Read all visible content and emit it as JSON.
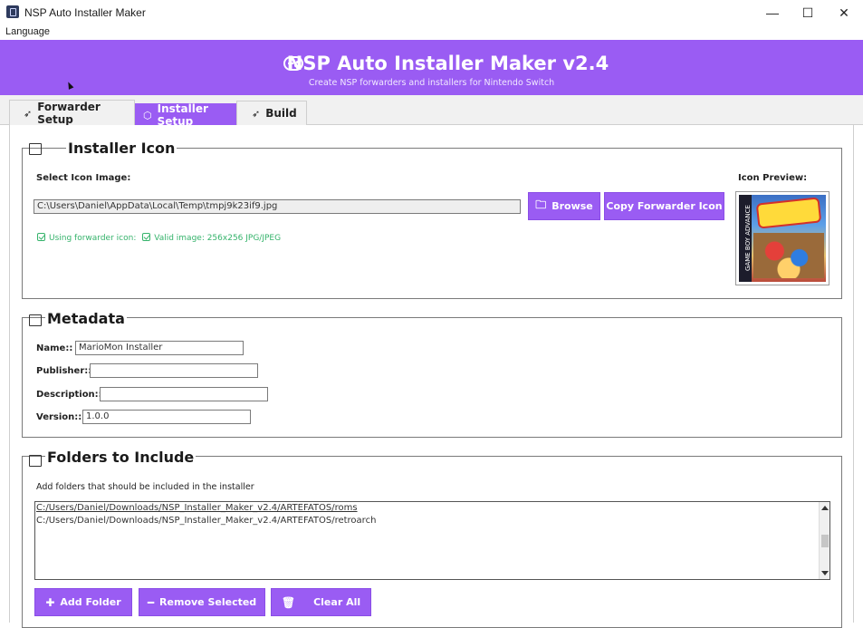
{
  "window": {
    "title": "NSP Auto Installer Maker",
    "controls": {
      "minimize": "—",
      "maximize": "☐",
      "close": "✕"
    }
  },
  "menu": {
    "items": [
      "Language"
    ]
  },
  "banner": {
    "title": "NSP Auto Installer Maker v2.4",
    "subtitle": "Create NSP forwarders and installers for Nintendo Switch",
    "icon": "gamepad-icon",
    "color": "#9a5cf3"
  },
  "tabs": [
    {
      "label": "Forwarder Setup",
      "icon": "rocket-icon",
      "active": false
    },
    {
      "label": "Installer Setup",
      "icon": "box-icon",
      "active": true
    },
    {
      "label": "Build",
      "icon": "rocket-icon",
      "active": false
    }
  ],
  "installer_icon": {
    "title": "Installer Icon",
    "select_label": "Select Icon Image:",
    "path": "C:\\Users\\Daniel\\AppData\\Local\\Temp\\tmpj9k23if9.jpg",
    "browse_label": "Browse",
    "copy_label": "Copy Forwarder Icon",
    "status_forwarder": "Using forwarder icon:",
    "status_valid": "Valid image: 256x256 JPG/JPEG",
    "preview_label": "Icon Preview:",
    "cover_side_text": "GAME BOY ADVANCE"
  },
  "metadata": {
    "title": "Metadata",
    "name_label": "Name::",
    "name_value": "MarioMon Installer",
    "publisher_label": "Publisher::",
    "publisher_value": "",
    "description_label": "Description::",
    "description_value": "",
    "version_label": "Version::",
    "version_value": "1.0.0"
  },
  "folders": {
    "title": "Folders to Include",
    "hint": "Add folders that should be included in the installer",
    "items": [
      "C:/Users/Daniel/Downloads/NSP_Installer_Maker_v2.4/ARTEFATOS/roms",
      "C:/Users/Daniel/Downloads/NSP_Installer_Maker_v2.4/ARTEFATOS/retroarch"
    ],
    "add_label": "Add Folder",
    "remove_label": "Remove Selected",
    "clear_label": "Clear All"
  }
}
